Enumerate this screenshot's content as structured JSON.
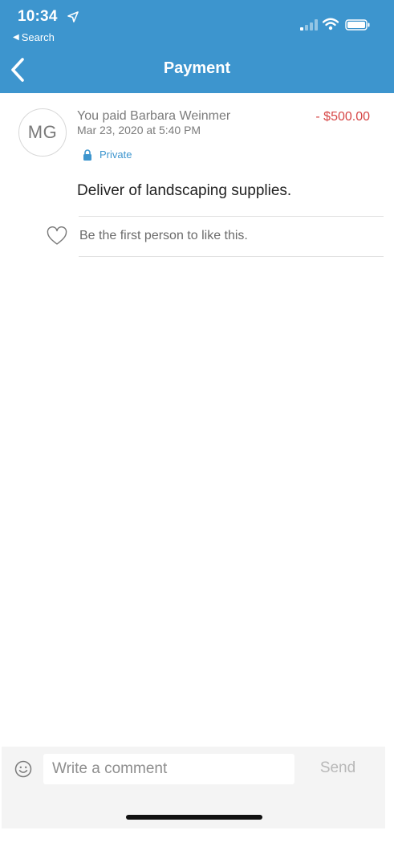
{
  "status_bar": {
    "time": "10:34",
    "back_to_app": "Search",
    "icons": [
      "location-arrow-icon",
      "cellular-signal-icon",
      "wifi-icon",
      "battery-icon"
    ]
  },
  "nav": {
    "title": "Payment",
    "back_icon": "chevron-left-icon"
  },
  "payment": {
    "avatar_initials": "MG",
    "description": "You paid Barbara Weinmer",
    "date": "Mar 23, 2020 at 5:40 PM",
    "privacy": "Private",
    "amount": "- $500.00",
    "note": "Deliver of landscaping supplies.",
    "likes_text": "Be the first person to like this."
  },
  "comment_bar": {
    "placeholder": "Write a comment",
    "send_label": "Send"
  },
  "colors": {
    "header": "#3d95ce",
    "accent": "#3d95ce",
    "amount_negative": "#d64545",
    "muted_text": "#7b7b7b",
    "comment_bar_bg": "#f4f4f4"
  }
}
